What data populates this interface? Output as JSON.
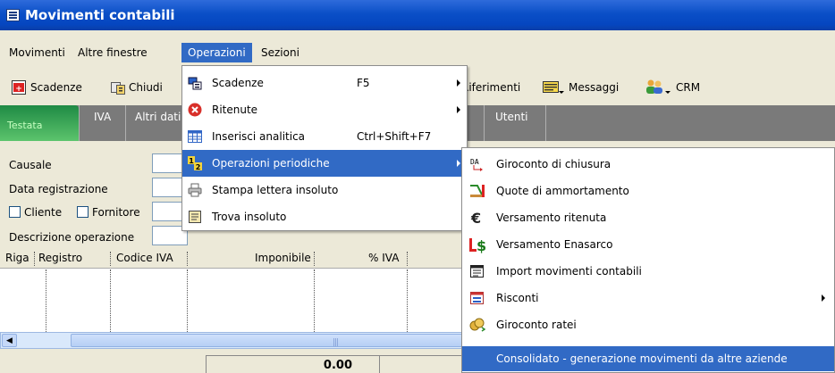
{
  "window": {
    "title": "Movimenti contabili"
  },
  "menubar": {
    "items": [
      {
        "label": "Movimenti",
        "active": false
      },
      {
        "label": "Altre finestre",
        "active": false
      },
      {
        "label": "Operazioni",
        "active": true
      },
      {
        "label": "Sezioni",
        "active": false
      }
    ]
  },
  "toolbar": {
    "scadenze_label": "Scadenze",
    "chiudi_label": "Chiudi",
    "riferimenti_label": "Riferimenti",
    "messaggi_label": "Messaggi",
    "crm_label": "CRM"
  },
  "tabs": {
    "testata": "Testata",
    "iva": "IVA",
    "altri_dati": "Altri dati",
    "utenti": "Utenti"
  },
  "form": {
    "causale_label": "Causale",
    "data_registrazione_label": "Data registrazione",
    "cliente_label": "Cliente",
    "fornitore_label": "Fornitore",
    "descrizione_label": "Descrizione operazione"
  },
  "grid": {
    "columns": [
      "Riga",
      "Registro",
      "Codice IVA",
      "Imponibile",
      "% IVA"
    ],
    "total": "0.00"
  },
  "operazioni_menu": {
    "items": [
      {
        "label": "Scadenze",
        "shortcut": "F5",
        "submenu": true,
        "icon": "calendar-icon"
      },
      {
        "label": "Ritenute",
        "shortcut": "",
        "submenu": true,
        "icon": "red-x-icon"
      },
      {
        "label": "Inserisci analitica",
        "shortcut": "Ctrl+Shift+F7",
        "submenu": false,
        "icon": "table-icon"
      },
      {
        "label": "Operazioni periodiche",
        "shortcut": "",
        "submenu": true,
        "icon": "numbers-icon",
        "highlighted": true
      },
      {
        "label": "Stampa lettera insoluto",
        "shortcut": "",
        "submenu": false,
        "icon": "printer-icon"
      },
      {
        "label": "Trova insoluto",
        "shortcut": "",
        "submenu": false,
        "icon": "document-icon"
      }
    ]
  },
  "periodiche_submenu": {
    "items": [
      {
        "label": "Giroconto di chiusura",
        "icon": "da-transfer-icon"
      },
      {
        "label": "Quote di ammortamento",
        "icon": "depreciation-icon"
      },
      {
        "label": "Versamento ritenuta",
        "icon": "euro-icon"
      },
      {
        "label": "Versamento Enasarco",
        "icon": "ls-dollar-icon"
      },
      {
        "label": "Import movimenti contabili",
        "icon": "import-icon"
      },
      {
        "label": "Risconti",
        "icon": "risconti-icon",
        "submenu": true
      },
      {
        "label": "Giroconto ratei",
        "icon": "coins-icon"
      },
      {
        "label": "Consolidato - generazione movimenti da altre aziende",
        "icon": "",
        "highlighted": true
      }
    ]
  },
  "colors": {
    "titlebar": "#0a4fc7",
    "highlight": "#316ac5",
    "tab_active": "#3ea858"
  }
}
